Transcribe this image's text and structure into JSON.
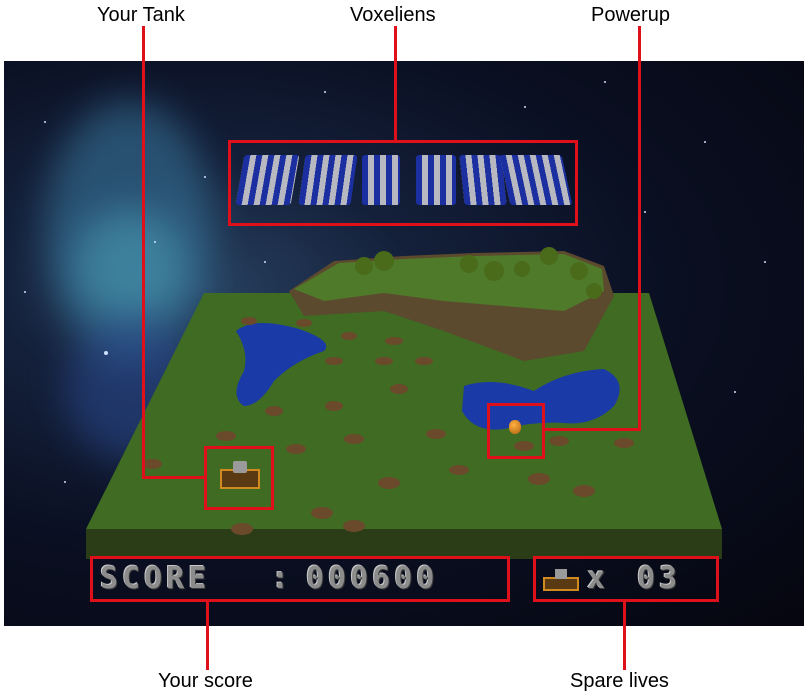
{
  "callouts": {
    "tank": "Your Tank",
    "voxeliens": "Voxeliens",
    "powerup": "Powerup",
    "score": "Your score",
    "lives": "Spare lives"
  },
  "hud": {
    "score_label": "SCORE",
    "score_sep": ":",
    "score_value": "000600",
    "lives_prefix": "x",
    "lives_value": "03"
  },
  "colors": {
    "annotation_red": "#e0101a",
    "grass": "#3f6b22",
    "water": "#1a3aa8",
    "dirt": "#6b4a2b",
    "alien_blue": "#1b2fa0",
    "alien_grey": "#b8b8c0",
    "hud_grey": "#8c8c8c"
  },
  "icons": {
    "tank": "tank-icon",
    "powerup": "orb-icon",
    "alien": "voxel-alien-icon"
  }
}
